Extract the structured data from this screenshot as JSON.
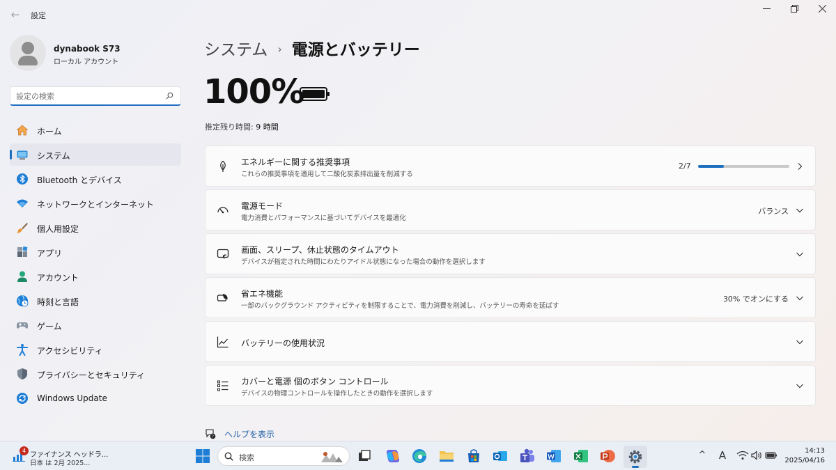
{
  "window": {
    "title": "設定",
    "back_icon": "back-arrow-icon",
    "controls": [
      "minimize-icon",
      "restore-icon",
      "close-icon"
    ]
  },
  "profile": {
    "name": "dynabook S73",
    "account_type": "ローカル アカウント"
  },
  "search": {
    "placeholder": "設定の検索"
  },
  "sidebar": {
    "items": [
      {
        "label": "ホーム",
        "icon": "home-icon"
      },
      {
        "label": "システム",
        "icon": "system-icon",
        "active": true
      },
      {
        "label": "Bluetooth とデバイス",
        "icon": "bluetooth-icon"
      },
      {
        "label": "ネットワークとインターネット",
        "icon": "wifi-icon"
      },
      {
        "label": "個人用設定",
        "icon": "brush-icon"
      },
      {
        "label": "アプリ",
        "icon": "apps-icon"
      },
      {
        "label": "アカウント",
        "icon": "account-icon"
      },
      {
        "label": "時刻と言語",
        "icon": "globe-clock-icon"
      },
      {
        "label": "ゲーム",
        "icon": "gamepad-icon"
      },
      {
        "label": "アクセシビリティ",
        "icon": "accessibility-icon"
      },
      {
        "label": "プライバシーとセキュリティ",
        "icon": "shield-icon"
      },
      {
        "label": "Windows Update",
        "icon": "update-icon"
      }
    ]
  },
  "breadcrumb": {
    "parent": "システム",
    "separator": "›",
    "current": "電源とバッテリー"
  },
  "battery": {
    "percent": "100%",
    "level": 1.0,
    "remaining_label": "推定残り時間:",
    "remaining_value": "9 時間"
  },
  "cards": [
    {
      "title": "エネルギーに関する推奨事項",
      "desc": "これらの推奨事項を適用して二酸化炭素排出量を削減する",
      "count": "2/7",
      "progress": 0.2857,
      "icon": "leaf-icon",
      "action": "chevron-right-icon"
    },
    {
      "title": "電源モード",
      "desc": "電力消費とパフォーマンスに基づいてデバイスを最適化",
      "value": "バランス",
      "icon": "gauge-icon",
      "action": "chevron-down-icon"
    },
    {
      "title": "画面、スリープ、休止状態のタイムアウト",
      "desc": "デバイスが指定された時間にわたりアイドル状態になった場合の動作を選択します",
      "icon": "screen-sleep-icon",
      "action": "chevron-down-icon"
    },
    {
      "title": "省エネ機能",
      "desc": "一部のバックグラウンド アクティビティを制限することで、電力消費を削減し、バッテリーの寿命を延ばす",
      "value": "30% でオンにする",
      "icon": "energy-saver-icon",
      "action": "chevron-down-icon"
    },
    {
      "title": "バッテリーの使用状況",
      "icon": "chart-line-icon",
      "action": "chevron-down-icon"
    },
    {
      "title": "カバーと電源 個のボタン コントロール",
      "desc": "デバイスの物理コントロールを操作したときの動作を選択します",
      "icon": "list-icon",
      "action": "chevron-down-icon"
    }
  ],
  "help": {
    "label": "ヘルプを表示"
  },
  "taskbar": {
    "widget": {
      "badge": "4",
      "line1": "ファイナンス ヘッドラ...",
      "line2": "日本 は 2月 2025..."
    },
    "search_label": "検索",
    "apps": [
      "start-icon",
      "task-view-icon",
      "copilot-icon",
      "edge-icon",
      "file-explorer-icon",
      "store-icon",
      "outlook-icon",
      "teams-icon",
      "word-icon",
      "excel-icon",
      "powerpoint-icon",
      "settings-icon"
    ],
    "tray": {
      "chevron": "^",
      "ime": "A",
      "time": "14:13",
      "date": "2025/04/16"
    }
  },
  "colors": {
    "accent": "#1f6fbf",
    "link": "#1f5fa8",
    "badge": "#c42b1c"
  }
}
